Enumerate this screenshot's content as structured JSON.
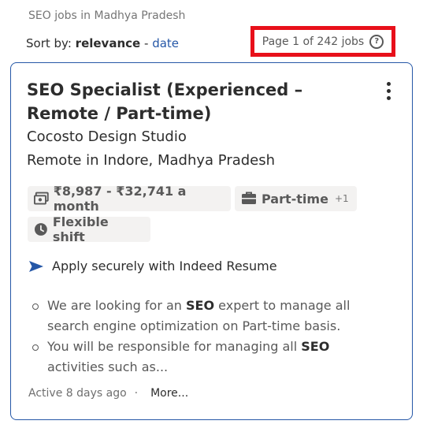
{
  "breadcrumb": "SEO jobs in Madhya Pradesh",
  "sort": {
    "prefix": "Sort by:",
    "active": "relevance",
    "separator": "-",
    "alternate": "date"
  },
  "pagination": {
    "label": "Page 1 of 242 jobs",
    "help_glyph": "?"
  },
  "job": {
    "title": "SEO Specialist (Experienced – Remote / Part-time)",
    "company": "Cocosto Design Studio",
    "location": "Remote in Indore, Madhya Pradesh",
    "salary": "₹8,987 - ₹32,741 a month",
    "job_type": "Part-time",
    "job_type_more": "+1",
    "shift": "Flexible shift",
    "apply_note": "Apply securely with Indeed Resume",
    "snippet": [
      {
        "before": "We are looking for an ",
        "highlight": "SEO",
        "after": " expert to manage all search engine optimization on Part-time basis."
      },
      {
        "before": "You will be responsible for managing all ",
        "highlight": "SEO",
        "after": " activities such as..."
      }
    ],
    "posted": "Active 8 days ago",
    "dot": "·",
    "more_link": "More..."
  },
  "colors": {
    "link": "#2557a7",
    "highlight_box": "#e8101a",
    "tag_bg": "#f3f2f1"
  },
  "icons": {
    "salary": "money-icon",
    "job_type": "briefcase-icon",
    "shift": "clock-icon",
    "apply": "send-arrow-icon",
    "help": "help-circle-icon",
    "menu": "kebab-menu-icon"
  }
}
